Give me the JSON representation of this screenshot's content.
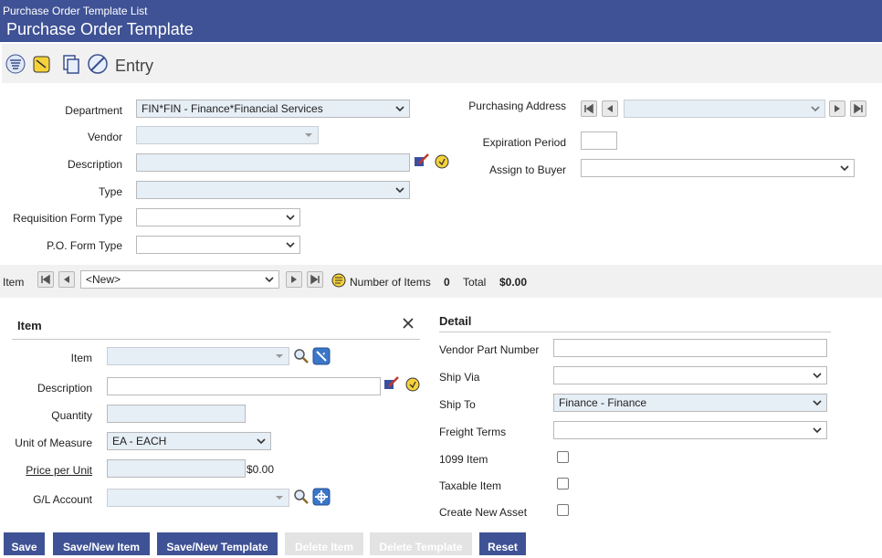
{
  "header": {
    "breadcrumb": "Purchase Order Template List",
    "title": "Purchase Order Template"
  },
  "toolbar": {
    "mode_label": "Entry"
  },
  "form": {
    "department": {
      "label": "Department",
      "value": "FIN*FIN - Finance*Financial Services"
    },
    "vendor": {
      "label": "Vendor",
      "value": ""
    },
    "description": {
      "label": "Description",
      "value": ""
    },
    "type": {
      "label": "Type",
      "value": ""
    },
    "req_form_type": {
      "label": "Requisition Form Type",
      "value": ""
    },
    "po_form_type": {
      "label": "P.O. Form Type",
      "value": ""
    },
    "purchasing_address": {
      "label": "Purchasing Address",
      "value": ""
    },
    "expiration_period": {
      "label": "Expiration Period",
      "value": ""
    },
    "assign_buyer": {
      "label": "Assign to Buyer",
      "value": ""
    }
  },
  "itembar": {
    "label": "Item",
    "selected": "<New>",
    "count_label": "Number of Items",
    "count": "0",
    "total_label": "Total",
    "total": "$0.00"
  },
  "item": {
    "title": "Item",
    "item_label": "Item",
    "description_label": "Description",
    "quantity_label": "Quantity",
    "uom_label": "Unit of Measure",
    "uom_value": "EA - EACH",
    "price_label": "Price per Unit",
    "price_ext": "$0.00",
    "gl_label": "G/L Account"
  },
  "detail": {
    "title": "Detail",
    "vendor_part_label": "Vendor Part Number",
    "ship_via_label": "Ship Via",
    "ship_to_label": "Ship To",
    "ship_to_value": "Finance - Finance",
    "freight_label": "Freight Terms",
    "item1099_label": "1099 Item",
    "taxable_label": "Taxable Item",
    "asset_label": "Create New Asset"
  },
  "buttons": {
    "save": "Save",
    "save_new_item": "Save/New Item",
    "save_new_template": "Save/New Template",
    "delete_item": "Delete Item",
    "delete_template": "Delete Template",
    "reset": "Reset"
  },
  "colors": {
    "header": "#3f5295",
    "button": "#3f5295",
    "field_fill": "#e6eef6"
  },
  "icons": [
    "list-icon",
    "notepad-icon",
    "copy-icon",
    "delete-icon",
    "spellcheck-icon",
    "notes-icon",
    "first-icon",
    "prev-icon",
    "next-icon",
    "last-icon",
    "search-icon",
    "lookup-icon",
    "close-icon"
  ]
}
